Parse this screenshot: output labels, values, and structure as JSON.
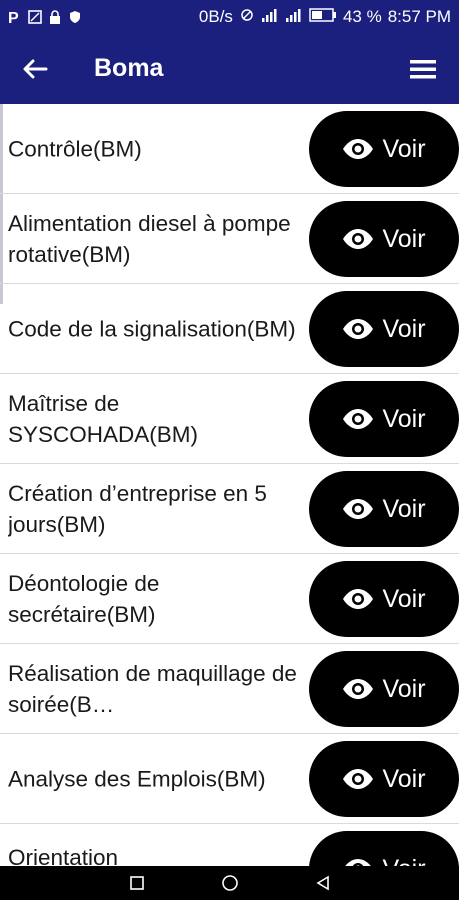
{
  "status_bar": {
    "left_icons": [
      "parking-icon",
      "screenshot-icon",
      "lock-icon",
      "shield-icon"
    ],
    "net_speed": "0B/s",
    "battery": "43 %",
    "time": "8:57 PM"
  },
  "app_bar": {
    "title": "Boma"
  },
  "list": {
    "button_label": "Voir",
    "items": [
      {
        "title": "Contrôle(BM)"
      },
      {
        "title": "Alimentation diesel à pompe rotative(BM)"
      },
      {
        "title": "Code de la signalisation(BM)"
      },
      {
        "title": "Maîtrise de SYSCOHADA(BM)"
      },
      {
        "title": "Création d’entreprise en 5 jours(BM)"
      },
      {
        "title": "Déontologie de secrétaire(BM)"
      },
      {
        "title": "Réalisation de maquillage de soirée(B…"
      },
      {
        "title": "Analyse des Emplois(BM)"
      },
      {
        "title": "Orientation"
      }
    ]
  },
  "colors": {
    "primary": "#1b1f7e",
    "button": "#000000",
    "divider": "#d9d9d9"
  }
}
